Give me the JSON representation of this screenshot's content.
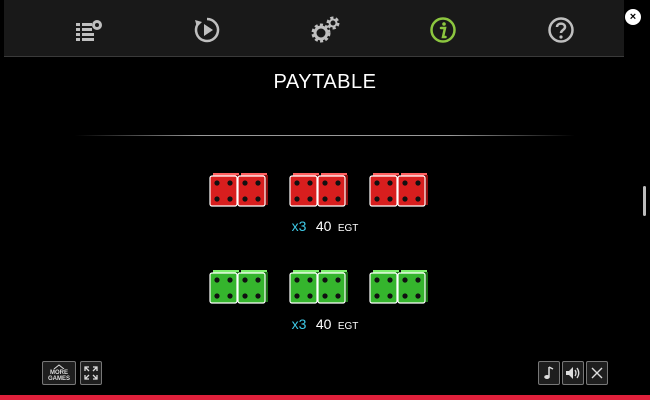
{
  "menu": {
    "tabs": [
      {
        "icon": "paytable-list-icon",
        "active": false
      },
      {
        "icon": "autoplay-icon",
        "active": false
      },
      {
        "icon": "settings-gear-icon",
        "active": false
      },
      {
        "icon": "info-icon",
        "active": true
      },
      {
        "icon": "help-icon",
        "active": false
      }
    ],
    "close_label": "×",
    "active_color": "#8cc63f"
  },
  "paytable": {
    "title": "PAYTABLE",
    "rows": [
      {
        "dice_color": "red",
        "combos": 3,
        "multiplier": "x3",
        "amount": "40",
        "currency": "EGT"
      },
      {
        "dice_color": "green",
        "combos": 3,
        "multiplier": "x3",
        "amount": "40",
        "currency": "EGT"
      }
    ]
  },
  "footer": {
    "more_games_line1": "MORE",
    "more_games_line2": "GAMES"
  },
  "colors": {
    "accent_red": "#e0203b",
    "multiplier": "#3ec9e6",
    "dice_red": "#d81e1e",
    "dice_green": "#35b52d"
  }
}
